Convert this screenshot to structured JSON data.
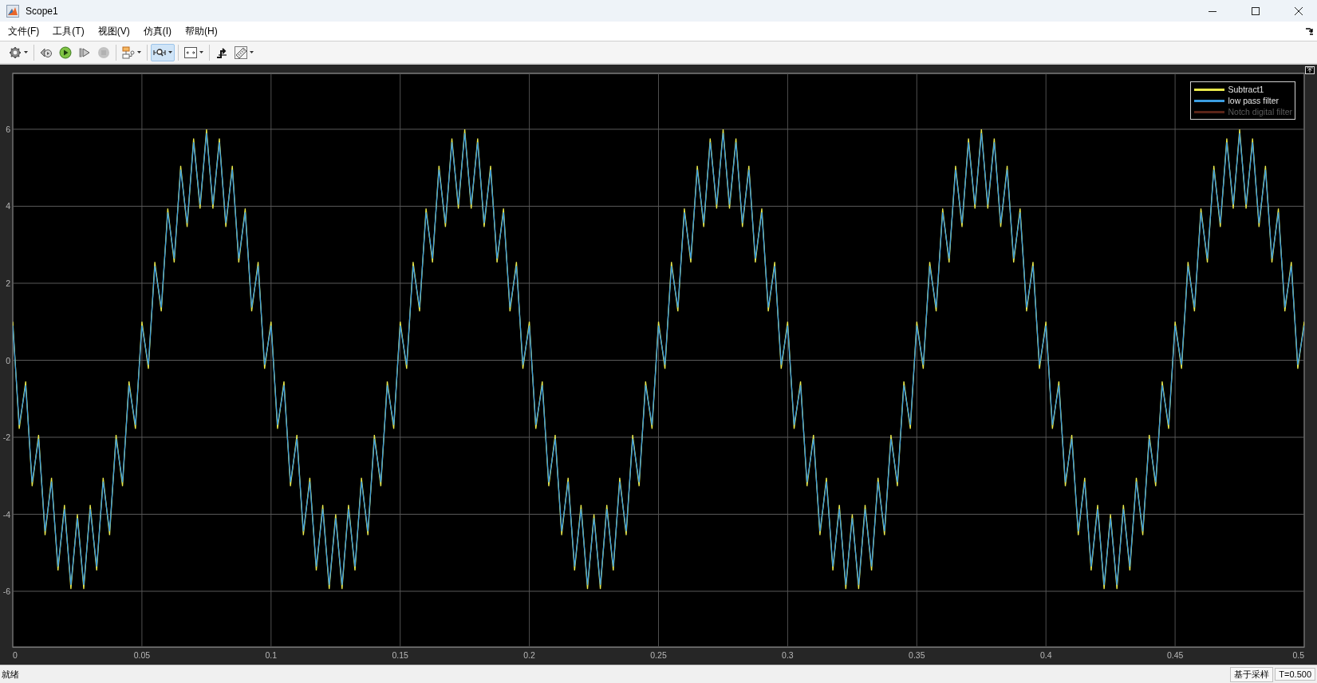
{
  "window": {
    "title": "Scope1"
  },
  "menu": [
    {
      "label": "文件(F)"
    },
    {
      "label": "工具(T)"
    },
    {
      "label": "视图(V)"
    },
    {
      "label": "仿真(I)"
    },
    {
      "label": "帮助(H)"
    }
  ],
  "toolbar": {
    "groups": [
      {
        "items": [
          {
            "kind": "settings",
            "caret": true,
            "selected": false,
            "disabled": false
          }
        ]
      },
      {
        "items": [
          {
            "kind": "step-back",
            "caret": false,
            "selected": false,
            "disabled": false
          },
          {
            "kind": "run",
            "caret": false,
            "selected": false,
            "disabled": false
          },
          {
            "kind": "step-forward",
            "caret": false,
            "selected": false,
            "disabled": false
          },
          {
            "kind": "stop",
            "caret": false,
            "selected": false,
            "disabled": true
          }
        ]
      },
      {
        "items": [
          {
            "kind": "properties",
            "caret": true,
            "selected": false,
            "disabled": false
          }
        ]
      },
      {
        "items": [
          {
            "kind": "zoom",
            "caret": true,
            "selected": true,
            "disabled": false
          }
        ]
      },
      {
        "items": [
          {
            "kind": "scale",
            "caret": true,
            "selected": false,
            "disabled": false
          }
        ]
      },
      {
        "items": [
          {
            "kind": "trigger",
            "caret": false,
            "selected": false,
            "disabled": false
          },
          {
            "kind": "measure",
            "caret": true,
            "selected": false,
            "disabled": false
          }
        ]
      }
    ]
  },
  "plot": {
    "extra_legend": [
      {
        "name": "Notch digital filter",
        "color": "#5a2418"
      }
    ],
    "chart_data": {
      "type": "line",
      "grid": true,
      "legend": true,
      "xlim": [
        0,
        0.5
      ],
      "ylim": [
        -7.45,
        7.45
      ],
      "xticks": [
        0,
        0.05,
        0.1,
        0.15,
        0.2,
        0.25,
        0.3,
        0.35,
        0.4,
        0.45,
        0.5
      ],
      "yticks": [
        -6,
        -4,
        -2,
        0,
        2,
        4,
        6
      ],
      "x": [
        0,
        0.0025,
        0.005,
        0.0075,
        0.01,
        0.0125,
        0.015,
        0.0175,
        0.02,
        0.0225,
        0.025,
        0.0275,
        0.03,
        0.0325,
        0.035,
        0.0375,
        0.04,
        0.0425,
        0.045,
        0.0475,
        0.05,
        0.0525,
        0.055,
        0.0575,
        0.06,
        0.0625,
        0.065,
        0.0675,
        0.07,
        0.0725,
        0.075,
        0.0775,
        0.08,
        0.0825,
        0.085,
        0.0875,
        0.09,
        0.0925,
        0.095,
        0.0975,
        0.1,
        0.1025,
        0.105,
        0.1075,
        0.11,
        0.1125,
        0.115,
        0.1175,
        0.12,
        0.1225,
        0.125,
        0.1275,
        0.13,
        0.1325,
        0.135,
        0.1375,
        0.14,
        0.1425,
        0.145,
        0.1475,
        0.15,
        0.1525,
        0.155,
        0.1575,
        0.16,
        0.1625,
        0.165,
        0.1675,
        0.17,
        0.1725,
        0.175,
        0.1775,
        0.18,
        0.1825,
        0.185,
        0.1875,
        0.19,
        0.1925,
        0.195,
        0.1975,
        0.2,
        0.2025,
        0.205,
        0.2075,
        0.21,
        0.2125,
        0.215,
        0.2175,
        0.22,
        0.2225,
        0.225,
        0.2275,
        0.23,
        0.2325,
        0.235,
        0.2375,
        0.24,
        0.2425,
        0.245,
        0.2475,
        0.25,
        0.2525,
        0.255,
        0.2575,
        0.26,
        0.2625,
        0.265,
        0.2675,
        0.27,
        0.2725,
        0.275,
        0.2775,
        0.28,
        0.2825,
        0.285,
        0.2875,
        0.29,
        0.2925,
        0.295,
        0.2975,
        0.3,
        0.3025,
        0.305,
        0.3075,
        0.31,
        0.3125,
        0.315,
        0.3175,
        0.32,
        0.3225,
        0.325,
        0.3275,
        0.33,
        0.3325,
        0.335,
        0.3375,
        0.34,
        0.3425,
        0.345,
        0.3475,
        0.35,
        0.3525,
        0.355,
        0.3575,
        0.36,
        0.3625,
        0.365,
        0.3675,
        0.37,
        0.3725,
        0.375,
        0.3775,
        0.38,
        0.3825,
        0.385,
        0.3875,
        0.39,
        0.3925,
        0.395,
        0.3975,
        0.4,
        0.4025,
        0.405,
        0.4075,
        0.41,
        0.4125,
        0.415,
        0.4175,
        0.42,
        0.4225,
        0.425,
        0.4275,
        0.43,
        0.4325,
        0.435,
        0.4375,
        0.44,
        0.4425,
        0.445,
        0.4475,
        0.45,
        0.4525,
        0.455,
        0.4575,
        0.46,
        0.4625,
        0.465,
        0.4675,
        0.47,
        0.4725,
        0.475,
        0.4775,
        0.48,
        0.4825,
        0.485,
        0.4875,
        0.49,
        0.4925,
        0.495,
        0.4975,
        0.5
      ],
      "series": [
        {
          "name": "Subtract1",
          "color": "#e8e84a",
          "values": [
            1,
            -1.78,
            -0.55,
            -3.27,
            -1.94,
            -4.54,
            -3.05,
            -5.46,
            -3.76,
            -5.94,
            -4,
            -5.94,
            -3.76,
            -5.46,
            -3.05,
            -4.54,
            -1.94,
            -3.27,
            -0.55,
            -1.78,
            1,
            -0.22,
            2.55,
            1.27,
            3.94,
            2.54,
            5.05,
            3.46,
            5.76,
            3.94,
            6,
            3.94,
            5.76,
            3.46,
            5.05,
            2.54,
            3.94,
            1.27,
            2.55,
            -0.22,
            1,
            -1.78,
            -0.55,
            -3.27,
            -1.94,
            -4.54,
            -3.05,
            -5.46,
            -3.76,
            -5.94,
            -4,
            -5.94,
            -3.76,
            -5.46,
            -3.05,
            -4.54,
            -1.94,
            -3.27,
            -0.55,
            -1.78,
            1,
            -0.22,
            2.55,
            1.27,
            3.94,
            2.54,
            5.05,
            3.46,
            5.76,
            3.94,
            6,
            3.94,
            5.76,
            3.46,
            5.05,
            2.54,
            3.94,
            1.27,
            2.55,
            -0.22,
            1,
            -1.78,
            -0.55,
            -3.27,
            -1.94,
            -4.54,
            -3.05,
            -5.46,
            -3.76,
            -5.94,
            -4,
            -5.94,
            -3.76,
            -5.46,
            -3.05,
            -4.54,
            -1.94,
            -3.27,
            -0.55,
            -1.78,
            1,
            -0.22,
            2.55,
            1.27,
            3.94,
            2.54,
            5.05,
            3.46,
            5.76,
            3.94,
            6,
            3.94,
            5.76,
            3.46,
            5.05,
            2.54,
            3.94,
            1.27,
            2.55,
            -0.22,
            1,
            -1.78,
            -0.55,
            -3.27,
            -1.94,
            -4.54,
            -3.05,
            -5.46,
            -3.76,
            -5.94,
            -4,
            -5.94,
            -3.76,
            -5.46,
            -3.05,
            -4.54,
            -1.94,
            -3.27,
            -0.55,
            -1.78,
            1,
            -0.22,
            2.55,
            1.27,
            3.94,
            2.54,
            5.05,
            3.46,
            5.76,
            3.94,
            6,
            3.94,
            5.76,
            3.46,
            5.05,
            2.54,
            3.94,
            1.27,
            2.55,
            -0.22,
            1,
            -1.78,
            -0.55,
            -3.27,
            -1.94,
            -4.54,
            -3.05,
            -5.46,
            -3.76,
            -5.94,
            -4,
            -5.94,
            -3.76,
            -5.46,
            -3.05,
            -4.54,
            -1.94,
            -3.27,
            -0.55,
            -1.78,
            1,
            -0.22,
            2.55,
            1.27,
            3.94,
            2.54,
            5.05,
            3.46,
            5.76,
            3.94,
            6,
            3.94,
            5.76,
            3.46,
            5.05,
            2.54,
            3.94,
            1.27,
            2.55,
            -0.22,
            1
          ]
        },
        {
          "name": "low pass filter",
          "color": "#3b9de0",
          "values": [
            0.9,
            -1.68,
            -0.65,
            -3.17,
            -2.04,
            -4.44,
            -3.15,
            -5.36,
            -3.86,
            -5.84,
            -4.1,
            -5.84,
            -3.86,
            -5.36,
            -3.15,
            -4.44,
            -2.04,
            -3.17,
            -0.65,
            -1.68,
            0.9,
            -0.12,
            2.45,
            1.37,
            3.84,
            2.64,
            4.95,
            3.56,
            5.66,
            4.04,
            5.9,
            4.04,
            5.66,
            3.56,
            4.95,
            2.64,
            3.84,
            1.37,
            2.45,
            -0.12,
            0.9,
            -1.68,
            -0.65,
            -3.17,
            -2.04,
            -4.44,
            -3.15,
            -5.36,
            -3.86,
            -5.84,
            -4.1,
            -5.84,
            -3.86,
            -5.36,
            -3.15,
            -4.44,
            -2.04,
            -3.17,
            -0.65,
            -1.68,
            0.9,
            -0.12,
            2.45,
            1.37,
            3.84,
            2.64,
            4.95,
            3.56,
            5.66,
            4.04,
            5.9,
            4.04,
            5.66,
            3.56,
            4.95,
            2.64,
            3.84,
            1.37,
            2.45,
            -0.12,
            0.9,
            -1.68,
            -0.65,
            -3.17,
            -2.04,
            -4.44,
            -3.15,
            -5.36,
            -3.86,
            -5.84,
            -4.1,
            -5.84,
            -3.86,
            -5.36,
            -3.15,
            -4.44,
            -2.04,
            -3.17,
            -0.65,
            -1.68,
            0.9,
            -0.12,
            2.45,
            1.37,
            3.84,
            2.64,
            4.95,
            3.56,
            5.66,
            4.04,
            5.9,
            4.04,
            5.66,
            3.56,
            4.95,
            2.64,
            3.84,
            1.37,
            2.45,
            -0.12,
            0.9,
            -1.68,
            -0.65,
            -3.17,
            -2.04,
            -4.44,
            -3.15,
            -5.36,
            -3.86,
            -5.84,
            -4.1,
            -5.84,
            -3.86,
            -5.36,
            -3.15,
            -4.44,
            -2.04,
            -3.17,
            -0.65,
            -1.68,
            0.9,
            -0.12,
            2.45,
            1.37,
            3.84,
            2.64,
            4.95,
            3.56,
            5.66,
            4.04,
            5.9,
            4.04,
            5.66,
            3.56,
            4.95,
            2.64,
            3.84,
            1.37,
            2.45,
            -0.12,
            0.9,
            -1.68,
            -0.65,
            -3.17,
            -2.04,
            -4.44,
            -3.15,
            -5.36,
            -3.86,
            -5.84,
            -4.1,
            -5.84,
            -3.86,
            -5.36,
            -3.15,
            -4.44,
            -2.04,
            -3.17,
            -0.65,
            -1.68,
            0.9,
            -0.12,
            2.45,
            1.37,
            3.84,
            2.64,
            4.95,
            3.56,
            5.66,
            4.04,
            5.9,
            4.04,
            5.66,
            3.56,
            4.95,
            2.64,
            3.84,
            1.37,
            2.45,
            -0.12,
            0.9
          ]
        }
      ]
    }
  },
  "status_bar": {
    "state": "就绪",
    "mode": "基于采样",
    "time": "T=0.500"
  }
}
